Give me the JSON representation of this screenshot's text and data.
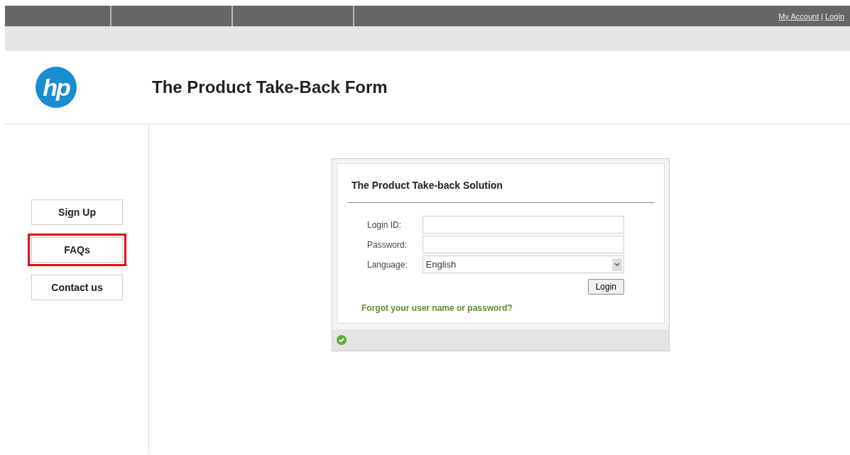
{
  "top_bar": {
    "links": [
      "My Account",
      "Login"
    ],
    "separator": "|"
  },
  "header": {
    "logo": "hp",
    "title": "The Product Take-Back Form"
  },
  "sidebar": {
    "items": [
      {
        "label": "Sign Up",
        "highlighted": false
      },
      {
        "label": "FAQs",
        "highlighted": true
      },
      {
        "label": "Contact us",
        "highlighted": false
      }
    ]
  },
  "login_panel": {
    "title": "The Product Take-back Solution",
    "fields": [
      {
        "kind": "text",
        "label": "Login ID:"
      },
      {
        "kind": "password",
        "label": "Password:"
      },
      {
        "kind": "select",
        "label": "Language:",
        "value": "English"
      }
    ],
    "button": "Login",
    "forgot_link": "Forgot your user name or password?",
    "status_ok": true
  }
}
